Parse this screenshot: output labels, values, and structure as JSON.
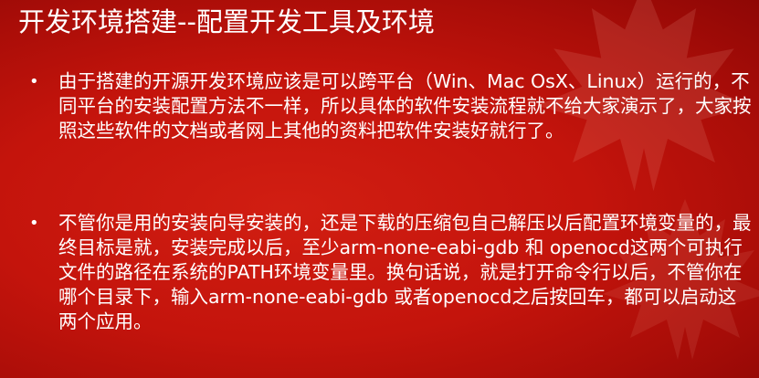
{
  "slide": {
    "title": "开发环境搭建--配置开发工具及环境",
    "bullet_symbol": "•",
    "bullets": [
      {
        "text": "由于搭建的开源开发环境应该是可以跨平台（Win、Mac OsX、Linux）运行的，不同平台的安装配置方法不一样，所以具体的软件安装流程就不给大家演示了，大家按照这些软件的文档或者网上其他的资料把软件安装好就行了。"
      },
      {
        "text": "不管你是用的安装向导安装的，还是下载的压缩包自己解压以后配置环境变量的，最终目标是就，安装完成以后，至少arm-none-eabi-gdb 和 openocd这两个可执行文件的路径在系统的PATH环境变量里。换句话说，就是打开命令行以后，不管你在哪个目录下，输入arm-none-eabi-gdb 或者openocd之后按回车，都可以启动这两个应用。"
      }
    ],
    "colors": {
      "background": "#c4140c",
      "text": "#ffffff",
      "leaf": "#f2a090"
    },
    "decoration": "maple-leaf-icon"
  }
}
